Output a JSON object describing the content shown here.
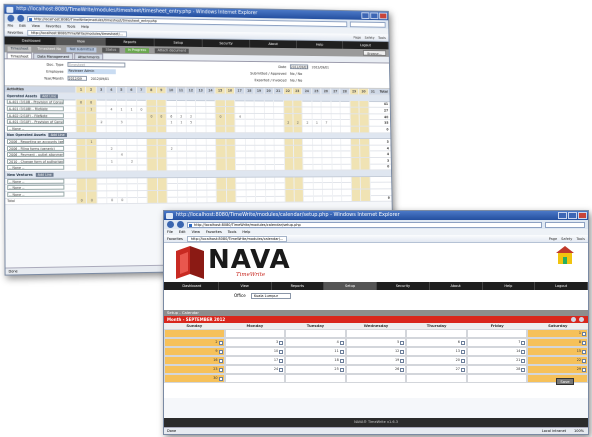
{
  "window1": {
    "title": "http://localhost:8080/TimeWrite/modules/timesheet/timesheet_entry.php - Windows Internet Explorer",
    "url": "http://localhost:8080/TimeWrite/modules/timesheet/timesheet_entry.php",
    "menu": [
      "File",
      "Edit",
      "View",
      "Favorites",
      "Tools",
      "Help"
    ],
    "fav_label": "Favorites",
    "tab_title": "http://localhost:8080/TimeWrite/modules/timesheet/...",
    "tools": [
      "Page",
      "Safety",
      "Tools"
    ],
    "nav": [
      "Dashboard",
      "View",
      "Reports",
      "Setup",
      "Security",
      "About",
      "Help",
      "Logout"
    ],
    "nav_active": 1,
    "bar": {
      "label1": "Timesheet",
      "f1": "Timesheet No",
      "f2": "Not submitted",
      "f3": "Status",
      "f4": "In Progress",
      "f5": "Attach document",
      "browse": "Browse..."
    },
    "tabs": [
      "Timesheet",
      "Data Management",
      "Attachments"
    ],
    "header": {
      "doc_type_label": "Doc. Type",
      "doc_type_value": "Timesheet",
      "employee_label": "Employee",
      "employee_value": "Reviewer Admin",
      "yearmonth_label": "Year/Month",
      "yearmonth_value": "2012/09",
      "yearmonth_extra": "2012/09/01",
      "date_label": "Date",
      "date_value": "2012/09/01",
      "date_extra": "2012/09/01",
      "submitted_label": "Submitted / Approved",
      "submitted_value": "No / No",
      "exported_label": "Exported / Invoiced",
      "exported_value": "No / No"
    },
    "grid_header": {
      "activities": "Activities",
      "total": "Total",
      "days": [
        "1",
        "2",
        "3",
        "4",
        "5",
        "6",
        "7",
        "8",
        "9",
        "10",
        "11",
        "12",
        "13",
        "14",
        "15",
        "16",
        "17",
        "18",
        "19",
        "20",
        "21",
        "22",
        "23",
        "24",
        "25",
        "26",
        "27",
        "28",
        "29",
        "30",
        "31"
      ]
    },
    "sections": [
      {
        "title": "Operated Assets",
        "add": "Add Line",
        "rows": [
          {
            "name": "A-401 (3/10B - Provision of Consultancy)",
            "vals": {
              "1": "8",
              "2": "8"
            },
            "total": "41"
          },
          {
            "name": "A-401 (3/10B) - FileNote",
            "vals": {
              "2": "1",
              "4": "4",
              "5": "1",
              "6": "1",
              "7": "0"
            },
            "total": "27"
          },
          {
            "name": "A-402 (2/10F) - FileNote",
            "vals": {
              "8": "0",
              "9": "0",
              "10": "6",
              "11": "2",
              "12": "2",
              "15": "0",
              "17": "4"
            },
            "total": "40"
          },
          {
            "name": "A-401 (3/10F) - Provision of Consultancy",
            "vals": {
              "3": "2",
              "5": "3",
              "10": "1",
              "11": "1",
              "12": "5",
              "22": "2",
              "23": "2",
              "24": "2",
              "25": "1",
              "26": "7"
            },
            "total": "35"
          },
          {
            "name": "-- None --",
            "vals": {},
            "total": "0"
          }
        ]
      },
      {
        "title": "Non Operated Assets",
        "add": "Add Line",
        "rows": [
          {
            "name": "2006 - Reporting on accounts (generic)",
            "vals": {
              "2": "1"
            },
            "total": "3"
          },
          {
            "name": "2006 - Filing forms (generic)",
            "vals": {
              "4": "2",
              "10": "2"
            },
            "total": "4"
          },
          {
            "name": "2006 - Payment - outlet alignment",
            "vals": {
              "5": "4"
            },
            "total": "4"
          },
          {
            "name": "2010 - Change form of authorised signatory",
            "vals": {
              "4": "1",
              "6": "2"
            },
            "total": "3"
          },
          {
            "name": "-- None --",
            "vals": {},
            "total": "0"
          }
        ]
      },
      {
        "title": "New Ventures",
        "add": "Add Line",
        "rows": [
          {
            "name": "-- None --",
            "vals": {},
            "total": ""
          },
          {
            "name": "-- None --",
            "vals": {},
            "total": ""
          },
          {
            "name": "-- None --",
            "vals": {},
            "total": ""
          }
        ]
      }
    ],
    "total_row": {
      "label": "Total",
      "vals": {
        "1": "0",
        "2": "0",
        "4": "0",
        "5": "0"
      },
      "total": "0"
    },
    "status": "Done"
  },
  "window2": {
    "title": "http://localhost:8080/TimeWrite/modules/calendar/setup.php - Windows Internet Explorer",
    "url": "http://localhost:8080/TimeWrite/modules/calendar/setup.php",
    "menu": [
      "File",
      "Edit",
      "View",
      "Favorites",
      "Tools",
      "Help"
    ],
    "fav_label": "Favorites",
    "tab_title": "http://localhost:8080/TimeWrite/modules/calendar/...",
    "tools": [
      "Page",
      "Safety",
      "Tools"
    ],
    "logo_text": "NAVA",
    "logo_sub": "TimeWrite",
    "nav": [
      "Dashboard",
      "View",
      "Reports",
      "Setup",
      "Security",
      "About",
      "Help",
      "Logout"
    ],
    "nav_active": 3,
    "office_label": "Office",
    "office_value": "Kuala Lumpur",
    "cal_title": "Setup - Calendar",
    "month": "Month - SEPTEMBER 2012",
    "days": [
      "Sunday",
      "Monday",
      "Tuesday",
      "Wednesday",
      "Thursday",
      "Friday",
      "Saturday"
    ],
    "weeks": [
      [
        "",
        "",
        "",
        "",
        "",
        "",
        "1"
      ],
      [
        "2",
        "3",
        "4",
        "5",
        "6",
        "7",
        "8"
      ],
      [
        "9",
        "10",
        "11",
        "12",
        "13",
        "14",
        "15"
      ],
      [
        "16",
        "17",
        "18",
        "19",
        "20",
        "21",
        "22"
      ],
      [
        "23",
        "24",
        "25",
        "26",
        "27",
        "28",
        "29"
      ],
      [
        "30",
        "",
        "",
        "",
        "",
        "",
        ""
      ]
    ],
    "save": "Save",
    "footer": "NAVA® TimeWrite v1.6.3",
    "status_left": "Done",
    "status_zone": "Local intranet",
    "status_zoom": "100%"
  },
  "colors": {
    "accent_red": "#d9261c",
    "weekend": "#f6c15a",
    "ie_title": "#2c5aa8",
    "nav_dark": "#1f1f1f"
  }
}
